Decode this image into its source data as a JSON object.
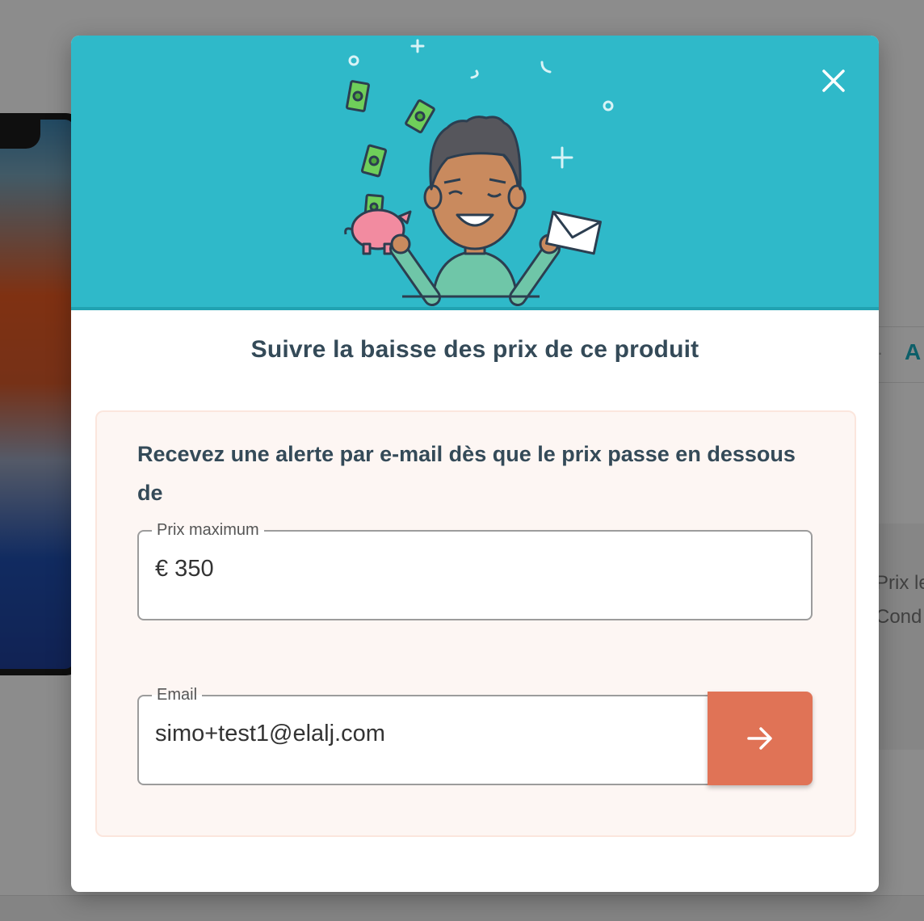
{
  "background": {
    "tab_label": "A",
    "tab_separator": "·",
    "info_line_1": "Prix le",
    "info_line_2": "Cond"
  },
  "modal": {
    "title": "Suivre la baisse des prix de ce produit",
    "alert_text": "Recevez une alerte par e-mail dès que le prix passe en dessous de",
    "price_field": {
      "label": "Prix maximum",
      "value": "€ 350"
    },
    "email_field": {
      "label": "Email",
      "value": "simo+test1@elalj.com"
    },
    "submit_icon": "arrow-right-icon",
    "close_icon": "close-icon"
  },
  "colors": {
    "header_bg": "#2fb9c9",
    "alert_bg": "#fdf6f3",
    "submit_bg": "#e07356",
    "title_text": "#344a58"
  }
}
